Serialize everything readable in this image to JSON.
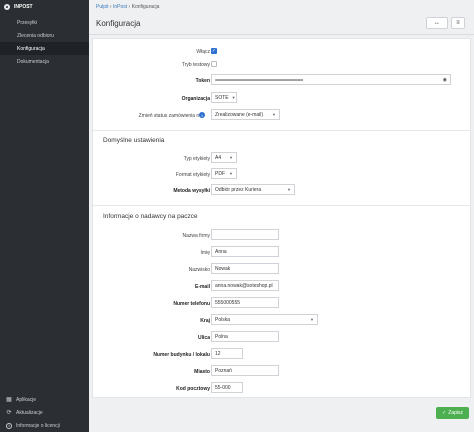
{
  "app": {
    "brand": "INPOST"
  },
  "sidebar": {
    "items": [
      {
        "label": "Przesyłki"
      },
      {
        "label": "Zlecenia odbioru"
      },
      {
        "label": "Konfiguracja"
      },
      {
        "label": "Dokumentacja"
      }
    ],
    "bottom": [
      {
        "label": "Aplikacje",
        "icon": "grid-icon"
      },
      {
        "label": "Aktualizacje",
        "icon": "refresh-icon"
      },
      {
        "label": "Informacje o licencji",
        "icon": "info-icon"
      }
    ]
  },
  "breadcrumb": {
    "root": "Pulpit",
    "sep": "›",
    "parent": "InPost",
    "current": "Konfiguracja"
  },
  "header": {
    "title": "Konfiguracja",
    "expand_icon": "expand-icon",
    "menu_icon": "menu-icon"
  },
  "form": {
    "enabled_label": "Włącz",
    "enabled": true,
    "test_mode_label": "Tryb testowy",
    "test_mode": false,
    "token_label": "Token",
    "token_value": "••••••••••••••••••••••••••••••••••••••••••••••••••••••••••••••••••••••••••••••••••••••••••••••••••••••••••••••",
    "organization_label": "Organizacja",
    "organization_value": "SOTE",
    "status_label": "Zmień status zamówienia na",
    "status_value": "Zrealizowane (e-mail)"
  },
  "defaults": {
    "section_title": "Domyślne ustawienia",
    "label_type_label": "Typ etykiety",
    "label_type_value": "A4",
    "label_format_label": "Format etykiety",
    "label_format_value": "PDF",
    "shipping_method_label": "Metoda wysyłki",
    "shipping_method_value": "Odbiór przez Kuriera"
  },
  "sender": {
    "section_title": "Informacje o nadawcy na paczce",
    "company_label": "Nazwa firmy",
    "company_value": "",
    "first_name_label": "Imię",
    "first_name_value": "Anna",
    "last_name_label": "Nazwisko",
    "last_name_value": "Nowak",
    "email_label": "E-mail",
    "email_value": "anna.nowak@soteshop.pl",
    "phone_label": "Numer telefonu",
    "phone_value": "555000555",
    "country_label": "Kraj",
    "country_value": "Polska",
    "street_label": "Ulica",
    "street_value": "Polna",
    "building_label": "Numer budynku / lokalu",
    "building_value": "12",
    "city_label": "Miasto",
    "city_value": "Poznań",
    "postal_label": "Kod pocztowy",
    "postal_value": "55-000"
  },
  "actions": {
    "save_label": "Zapisz"
  }
}
